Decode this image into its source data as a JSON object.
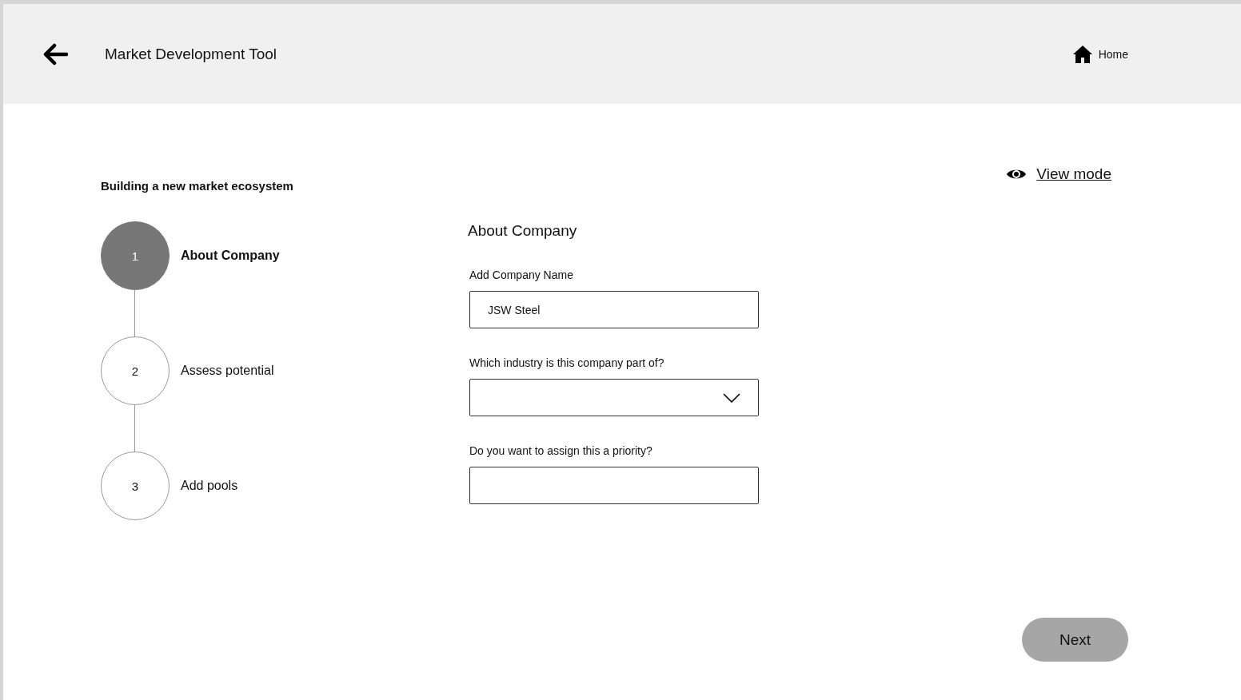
{
  "header": {
    "title": "Market Development Tool",
    "home_link": "Home"
  },
  "view_mode_link": "View mode",
  "subtitle": "Building a new market ecosystem",
  "steps": [
    {
      "number": "1",
      "label": "About Company",
      "selected": true
    },
    {
      "number": "2",
      "label": "Assess potential",
      "selected": false
    },
    {
      "number": "3",
      "label": "Add pools",
      "selected": false
    }
  ],
  "form": {
    "heading": "About Company",
    "fields": [
      {
        "kind": "text",
        "label": "Add Company Name",
        "value": "JSW Steel"
      },
      {
        "kind": "select",
        "label": "Which industry is this company part of?"
      },
      {
        "kind": "text",
        "label": "Do you want to assign this a priority?"
      }
    ]
  },
  "next_button": "Next"
}
